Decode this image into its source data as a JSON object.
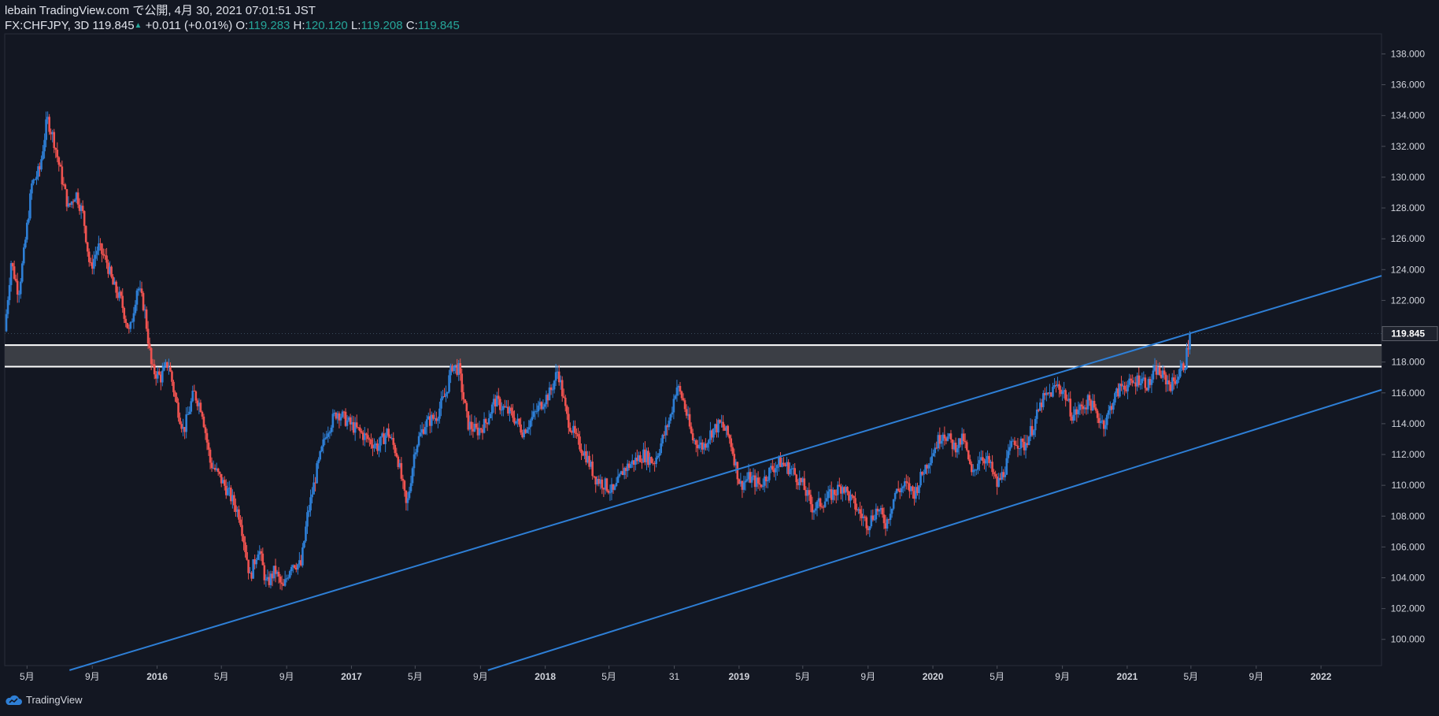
{
  "header": {
    "publish_line": "lebain TradingView.com で公開, 4月 30, 2021 07:01:51 JST",
    "symbol": "FX:CHFJPY, 3D",
    "last": "119.845",
    "change": "+0.011 (+0.01%)",
    "o_label": "O:",
    "o_value": "119.283",
    "h_label": "H:",
    "h_value": "120.120",
    "l_label": "L:",
    "l_value": "119.208",
    "c_label": "C:",
    "c_value": "119.845"
  },
  "footer": {
    "brand": "TradingView"
  },
  "colors": {
    "background": "#131722",
    "up": "#2e7fd6",
    "down": "#ef5350",
    "trendline": "#2e7fd6",
    "zone_fill": "#3b3e45",
    "zone_line": "#ffffff",
    "text": "#d1d4dc",
    "teal": "#26a69a",
    "axis_line": "#2a2e39"
  },
  "chart_data": {
    "type": "candlestick",
    "symbol": "FX:CHFJPY",
    "timeframe": "3D",
    "xlim": [
      "2015-03-20",
      "2022-04-25"
    ],
    "ylim": [
      98.3,
      139.3
    ],
    "y_ticks": [
      "100.000",
      "102.000",
      "104.000",
      "106.000",
      "108.000",
      "110.000",
      "112.000",
      "114.000",
      "116.000",
      "118.000",
      "120.000",
      "122.000",
      "124.000",
      "126.000",
      "128.000",
      "130.000",
      "132.000",
      "134.000",
      "136.000",
      "138.000"
    ],
    "x_ticks": [
      {
        "date": "2015-05-01",
        "label": "5月"
      },
      {
        "date": "2015-09-01",
        "label": "9月"
      },
      {
        "date": "2016-01-01",
        "label": "2016"
      },
      {
        "date": "2016-05-01",
        "label": "5月"
      },
      {
        "date": "2016-09-01",
        "label": "9月"
      },
      {
        "date": "2017-01-01",
        "label": "2017"
      },
      {
        "date": "2017-05-01",
        "label": "5月"
      },
      {
        "date": "2017-09-01",
        "label": "9月"
      },
      {
        "date": "2018-01-01",
        "label": "2018"
      },
      {
        "date": "2018-05-01",
        "label": "5月"
      },
      {
        "date": "2018-09-01",
        "label": "31"
      },
      {
        "date": "2019-01-01",
        "label": "2019"
      },
      {
        "date": "2019-05-01",
        "label": "5月"
      },
      {
        "date": "2019-09-01",
        "label": "9月"
      },
      {
        "date": "2020-01-01",
        "label": "2020"
      },
      {
        "date": "2020-05-01",
        "label": "5月"
      },
      {
        "date": "2020-09-01",
        "label": "9月"
      },
      {
        "date": "2021-01-01",
        "label": "2021"
      },
      {
        "date": "2021-05-01",
        "label": "5月"
      },
      {
        "date": "2021-09-01",
        "label": "9月"
      },
      {
        "date": "2022-01-01",
        "label": "2022"
      }
    ],
    "last_price_label": "119.845",
    "last_price": 119.845,
    "price_path": [
      [
        "2015-03-20",
        120.0
      ],
      [
        "2015-04-01",
        124.5
      ],
      [
        "2015-04-15",
        122.5
      ],
      [
        "2015-04-25",
        125.0
      ],
      [
        "2015-05-10",
        129.5
      ],
      [
        "2015-05-25",
        130.5
      ],
      [
        "2015-06-08",
        133.8
      ],
      [
        "2015-06-20",
        132.5
      ],
      [
        "2015-07-05",
        130.0
      ],
      [
        "2015-07-18",
        128.0
      ],
      [
        "2015-08-01",
        129.0
      ],
      [
        "2015-08-15",
        127.5
      ],
      [
        "2015-08-28",
        124.0
      ],
      [
        "2015-09-12",
        125.5
      ],
      [
        "2015-09-28",
        124.5
      ],
      [
        "2015-10-10",
        123.0
      ],
      [
        "2015-10-25",
        122.0
      ],
      [
        "2015-11-10",
        119.8
      ],
      [
        "2015-11-25",
        123.0
      ],
      [
        "2015-12-08",
        121.5
      ],
      [
        "2015-12-22",
        117.5
      ],
      [
        "2016-01-08",
        117.0
      ],
      [
        "2016-01-22",
        118.0
      ],
      [
        "2016-02-05",
        115.5
      ],
      [
        "2016-02-20",
        113.5
      ],
      [
        "2016-03-10",
        116.0
      ],
      [
        "2016-03-25",
        115.0
      ],
      [
        "2016-04-10",
        111.5
      ],
      [
        "2016-04-28",
        110.5
      ],
      [
        "2016-05-15",
        109.5
      ],
      [
        "2016-06-05",
        108.0
      ],
      [
        "2016-06-24",
        104.0
      ],
      [
        "2016-07-10",
        106.0
      ],
      [
        "2016-07-25",
        103.5
      ],
      [
        "2016-08-10",
        104.5
      ],
      [
        "2016-08-25",
        103.2
      ],
      [
        "2016-09-10",
        105.0
      ],
      [
        "2016-09-28",
        104.8
      ],
      [
        "2016-10-10",
        108.0
      ],
      [
        "2016-10-28",
        111.0
      ],
      [
        "2016-11-15",
        113.5
      ],
      [
        "2016-12-05",
        114.8
      ],
      [
        "2016-12-28",
        114.0
      ],
      [
        "2017-01-15",
        113.5
      ],
      [
        "2017-02-01",
        113.0
      ],
      [
        "2017-02-20",
        112.5
      ],
      [
        "2017-03-10",
        113.5
      ],
      [
        "2017-03-28",
        112.0
      ],
      [
        "2017-04-15",
        108.5
      ],
      [
        "2017-05-01",
        112.5
      ],
      [
        "2017-05-20",
        114.0
      ],
      [
        "2017-06-10",
        114.5
      ],
      [
        "2017-06-28",
        116.0
      ],
      [
        "2017-07-10",
        117.8
      ],
      [
        "2017-07-22",
        117.5
      ],
      [
        "2017-08-08",
        114.0
      ],
      [
        "2017-08-25",
        113.5
      ],
      [
        "2017-09-10",
        114.0
      ],
      [
        "2017-09-28",
        115.5
      ],
      [
        "2017-10-15",
        115.0
      ],
      [
        "2017-11-01",
        114.5
      ],
      [
        "2017-11-20",
        113.5
      ],
      [
        "2017-12-10",
        114.5
      ],
      [
        "2017-12-28",
        115.5
      ],
      [
        "2018-01-10",
        116.0
      ],
      [
        "2018-01-25",
        117.5
      ],
      [
        "2018-02-10",
        114.5
      ],
      [
        "2018-02-28",
        113.0
      ],
      [
        "2018-03-18",
        112.0
      ],
      [
        "2018-04-05",
        110.5
      ],
      [
        "2018-04-25",
        110.0
      ],
      [
        "2018-05-10",
        109.5
      ],
      [
        "2018-05-28",
        111.0
      ],
      [
        "2018-06-15",
        111.5
      ],
      [
        "2018-07-05",
        112.0
      ],
      [
        "2018-07-25",
        111.5
      ],
      [
        "2018-08-10",
        113.0
      ],
      [
        "2018-08-25",
        114.5
      ],
      [
        "2018-09-05",
        116.5
      ],
      [
        "2018-09-18",
        115.5
      ],
      [
        "2018-10-05",
        113.0
      ],
      [
        "2018-10-25",
        112.5
      ],
      [
        "2018-11-10",
        113.5
      ],
      [
        "2018-11-28",
        114.0
      ],
      [
        "2018-12-15",
        113.0
      ],
      [
        "2019-01-03",
        110.0
      ],
      [
        "2019-01-20",
        110.5
      ],
      [
        "2019-02-10",
        110.0
      ],
      [
        "2019-03-01",
        111.0
      ],
      [
        "2019-03-20",
        111.5
      ],
      [
        "2019-04-10",
        111.0
      ],
      [
        "2019-05-01",
        110.0
      ],
      [
        "2019-05-20",
        108.5
      ],
      [
        "2019-06-10",
        109.0
      ],
      [
        "2019-06-28",
        109.5
      ],
      [
        "2019-07-15",
        110.0
      ],
      [
        "2019-08-01",
        109.0
      ],
      [
        "2019-08-20",
        108.0
      ],
      [
        "2019-09-01",
        107.5
      ],
      [
        "2019-09-18",
        108.5
      ],
      [
        "2019-10-05",
        107.5
      ],
      [
        "2019-10-22",
        109.5
      ],
      [
        "2019-11-10",
        110.0
      ],
      [
        "2019-11-28",
        109.5
      ],
      [
        "2019-12-15",
        111.0
      ],
      [
        "2020-01-05",
        112.5
      ],
      [
        "2020-01-20",
        113.5
      ],
      [
        "2020-02-10",
        112.5
      ],
      [
        "2020-02-28",
        113.0
      ],
      [
        "2020-03-15",
        110.5
      ],
      [
        "2020-03-30",
        112.0
      ],
      [
        "2020-04-15",
        111.5
      ],
      [
        "2020-05-01",
        110.0
      ],
      [
        "2020-05-15",
        111.0
      ],
      [
        "2020-06-01",
        113.0
      ],
      [
        "2020-06-20",
        112.5
      ],
      [
        "2020-07-10",
        114.0
      ],
      [
        "2020-07-25",
        115.5
      ],
      [
        "2020-08-10",
        116.0
      ],
      [
        "2020-08-22",
        116.5
      ],
      [
        "2020-09-05",
        116.0
      ],
      [
        "2020-09-20",
        114.5
      ],
      [
        "2020-10-05",
        115.0
      ],
      [
        "2020-10-22",
        115.5
      ],
      [
        "2020-11-05",
        114.5
      ],
      [
        "2020-11-20",
        114.0
      ],
      [
        "2020-12-05",
        115.5
      ],
      [
        "2020-12-22",
        116.5
      ],
      [
        "2021-01-08",
        116.5
      ],
      [
        "2021-01-25",
        117.0
      ],
      [
        "2021-02-10",
        116.5
      ],
      [
        "2021-02-25",
        117.5
      ],
      [
        "2021-03-10",
        117.0
      ],
      [
        "2021-03-25",
        116.5
      ],
      [
        "2021-04-08",
        117.2
      ],
      [
        "2021-04-20",
        118.0
      ],
      [
        "2021-04-30",
        119.845
      ]
    ],
    "annotations": {
      "resistance_zone": {
        "upper": 119.1,
        "lower": 117.7
      },
      "trendlines": [
        {
          "name": "upper channel line",
          "from": [
            "2015-07-20",
            98.0
          ],
          "to": [
            "2022-04-25",
            123.6
          ]
        },
        {
          "name": "lower channel line",
          "from": [
            "2017-09-15",
            98.0
          ],
          "to": [
            "2022-04-25",
            116.2
          ]
        }
      ]
    }
  }
}
